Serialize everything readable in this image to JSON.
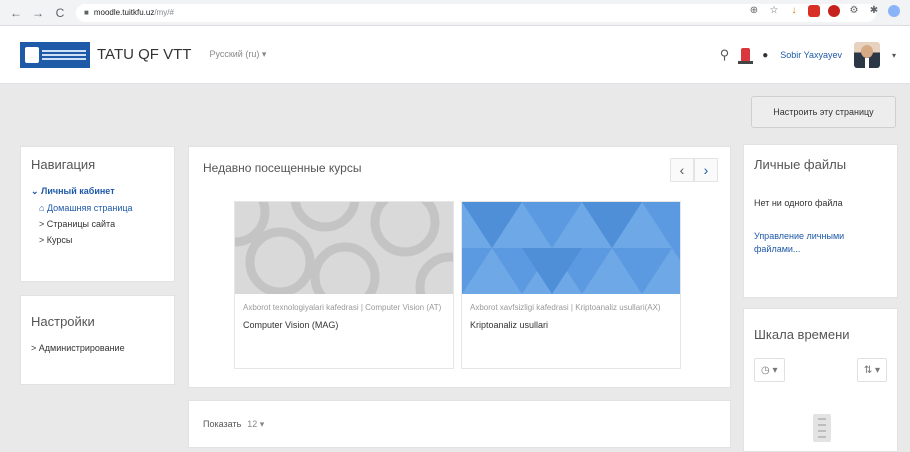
{
  "browser": {
    "url_host": "moodle.tuitkfu.uz",
    "url_path": "/my/#",
    "back_glyph": "←",
    "forward_glyph": "→",
    "reload_glyph": "C"
  },
  "header": {
    "site_name": "TATU QF VTT",
    "language": "Русский (ru) ▾",
    "user_name": "Sobir Yaxyayev",
    "user_caret": "▾"
  },
  "customize_button": "Настроить эту страницу",
  "navigation": {
    "title": "Навигация",
    "items": [
      {
        "label": "⌄ Личный кабинет"
      },
      {
        "label": "Домашняя страница"
      },
      {
        "label": "> Страницы сайта"
      },
      {
        "label": "> Курсы"
      }
    ]
  },
  "settings": {
    "title": "Настройки",
    "admin": "> Администрирование"
  },
  "recent_courses": {
    "title": "Недавно посещенные курсы",
    "prev": "‹",
    "next": "›",
    "courses": [
      {
        "category": "Axborot texnologiyalari kafedrasi | Computer Vision (AT)",
        "name": "Computer Vision (MAG)"
      },
      {
        "category": "Axborot xavfsizligi kafedrasi | Kriptoanaliz usullari(AX)",
        "name": "Kriptoanaliz usullari"
      }
    ]
  },
  "show": {
    "label": "Показать",
    "value": "12 ▾"
  },
  "private_files": {
    "title": "Личные файлы",
    "empty": "Нет ни одного файла",
    "manage": "Управление личными файлами..."
  },
  "timeline": {
    "title": "Шкала времени",
    "filter_icon": "◷ ▾",
    "sort_icon": "⇅ ▾"
  }
}
